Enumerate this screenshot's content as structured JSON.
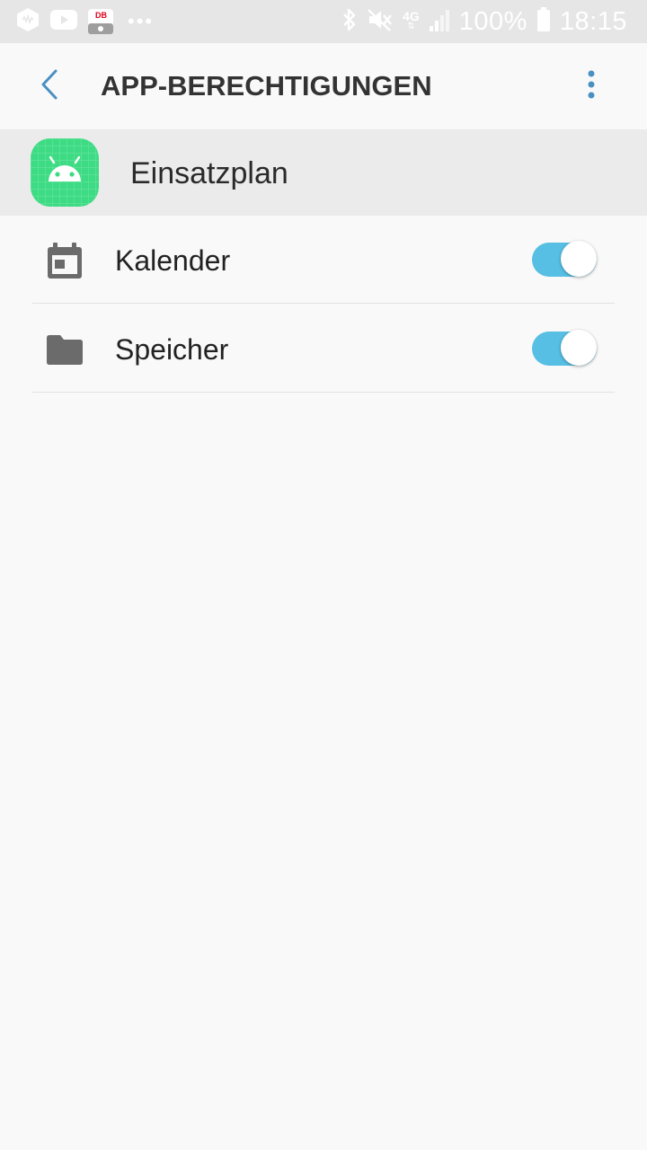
{
  "status_bar": {
    "left_icons": [
      "app-hexagon-icon",
      "youtube-icon",
      "db-navigator-icon",
      "more-notifications-icon"
    ],
    "db_label": "DB",
    "network": "4G",
    "battery_percent": "100%",
    "time": "18:15",
    "right_icons": [
      "bluetooth-icon",
      "mute-icon",
      "network-4g-icon",
      "signal-icon",
      "battery-icon"
    ]
  },
  "app_bar": {
    "title": "APP-BERECHTIGUNGEN",
    "back_icon": "back-arrow-icon",
    "more_icon": "more-options-icon"
  },
  "app": {
    "name": "Einsatzplan",
    "icon": "android-app-icon",
    "icon_color": "#3ddc84"
  },
  "permissions": [
    {
      "label": "Kalender",
      "icon": "calendar-icon",
      "enabled": true
    },
    {
      "label": "Speicher",
      "icon": "folder-icon",
      "enabled": true
    }
  ],
  "colors": {
    "accent": "#56bfe3",
    "back_arrow": "#4a90c2",
    "background": "#f9f9f9"
  }
}
